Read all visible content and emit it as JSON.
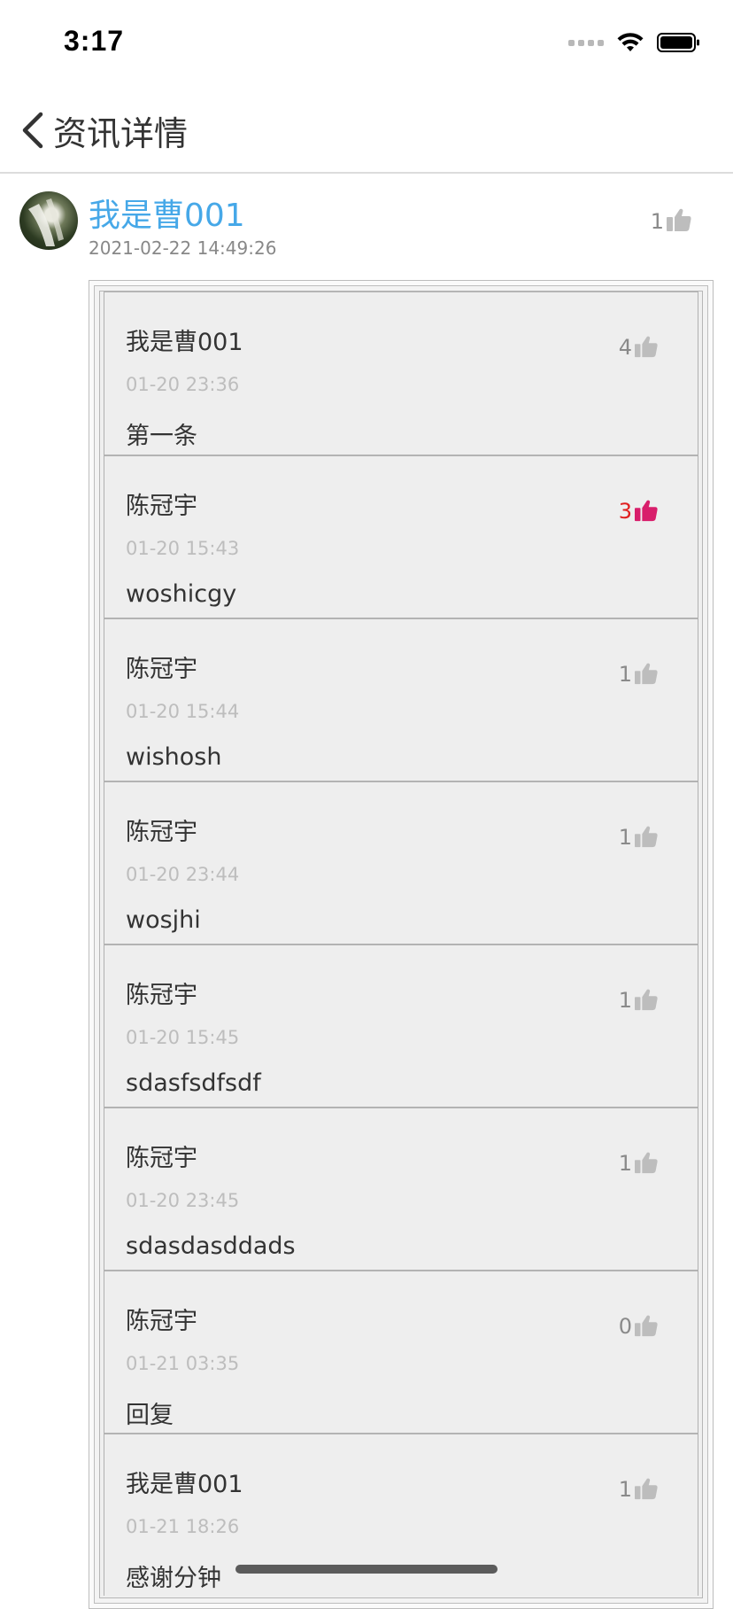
{
  "status": {
    "time": "3:17"
  },
  "nav": {
    "title": "资讯详情"
  },
  "post": {
    "author": "我是曹001",
    "time": "2021-02-22 14:49:26",
    "likes": "1"
  },
  "colors": {
    "link_blue": "#46a8e8",
    "like_active_red": "#e02020",
    "like_active_icon": "#d81e6b",
    "like_inactive": "#bdbdbd"
  },
  "comments": [
    {
      "name": "我是曹001",
      "time": "01-20 23:36",
      "text": "第一条",
      "likes": "4",
      "liked": false
    },
    {
      "name": "陈冠宇",
      "time": "01-20 15:43",
      "text": "woshicgy",
      "likes": "3",
      "liked": true
    },
    {
      "name": "陈冠宇",
      "time": "01-20 15:44",
      "text": "wishosh",
      "likes": "1",
      "liked": false
    },
    {
      "name": "陈冠宇",
      "time": "01-20 23:44",
      "text": "wosjhi",
      "likes": "1",
      "liked": false
    },
    {
      "name": "陈冠宇",
      "time": "01-20 15:45",
      "text": "sdasfsdfsdf",
      "likes": "1",
      "liked": false
    },
    {
      "name": "陈冠宇",
      "time": "01-20 23:45",
      "text": "sdasdasddads",
      "likes": "1",
      "liked": false
    },
    {
      "name": "陈冠宇",
      "time": "01-21 03:35",
      "text": "回复",
      "likes": "0",
      "liked": false
    },
    {
      "name": "我是曹001",
      "time": "01-21 18:26",
      "text": "感谢分钟",
      "likes": "1",
      "liked": false
    }
  ]
}
